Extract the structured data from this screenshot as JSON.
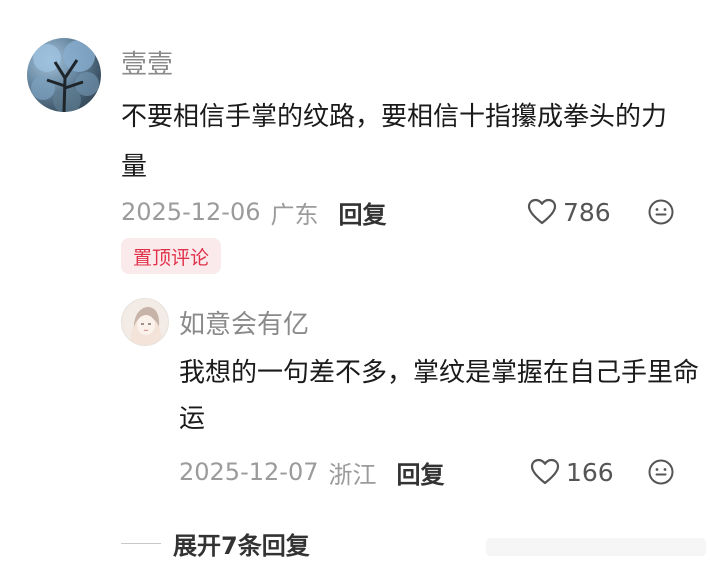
{
  "comment": {
    "username": "壹壹",
    "text": "不要相信手掌的纹路，要相信十指攥成拳头的力量",
    "date": "2025-12-06",
    "region": "广东",
    "reply_label": "回复",
    "likes": "786",
    "pinned_label": "置顶评论"
  },
  "reply": {
    "username": "如意会有亿",
    "text": "我想的一句差不多，掌纹是掌握在自己手里命运",
    "date": "2025-12-07",
    "region": "浙江",
    "reply_label": "回复",
    "likes": "166"
  },
  "expand_label": "展开7条回复",
  "colors": {
    "pin_badge_bg": "#fbeaec",
    "pin_badge_text": "#e0314a",
    "meta_text": "#9b9b9b"
  },
  "icons": [
    "heart-outline-icon",
    "emoji-smile-icon",
    "tree-avatar",
    "anime-girl-avatar"
  ]
}
